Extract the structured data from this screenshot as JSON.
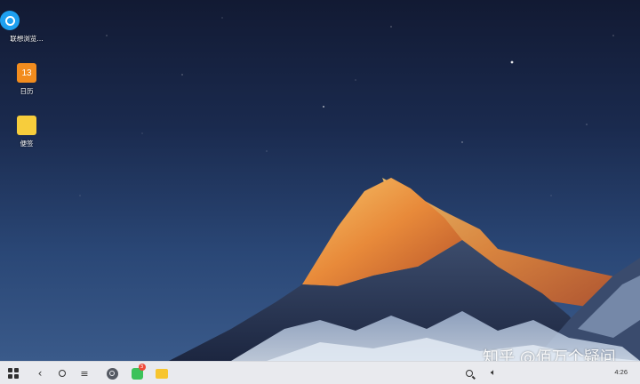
{
  "desktop": {
    "icons": [
      {
        "label": "联想浏览…",
        "icon": "browser-icon"
      },
      {
        "label": "日历",
        "icon": "calendar-icon",
        "glyph": "13"
      },
      {
        "label": "便签",
        "icon": "notes-icon"
      }
    ],
    "wallpaper": "starry-night-mountain"
  },
  "taskbar": {
    "start": "start-menu-icon",
    "nav": {
      "back": "‹",
      "home": "home-icon",
      "menu": "≡"
    },
    "apps": [
      {
        "name": "browser-icon"
      },
      {
        "name": "messages-icon",
        "badge": "3",
        "color": "#3cc25a"
      },
      {
        "name": "folder-icon",
        "color": "#f7c52e"
      }
    ],
    "tray": {
      "search": "search-icon",
      "volume": "volume-icon",
      "clock": "4:26"
    }
  },
  "watermark": "知乎 @佰万个疑问"
}
